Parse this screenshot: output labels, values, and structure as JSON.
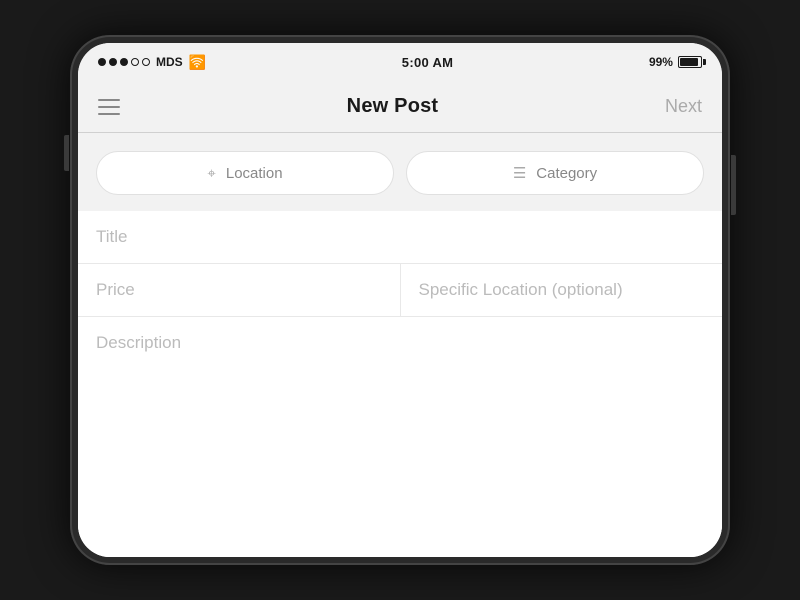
{
  "statusBar": {
    "carrier": "MDS",
    "time": "5:00 AM",
    "battery": "99%"
  },
  "navBar": {
    "title": "New Post",
    "nextLabel": "Next"
  },
  "tags": {
    "locationLabel": "Location",
    "categoryLabel": "Category"
  },
  "form": {
    "titlePlaceholder": "Title",
    "pricePlaceholder": "Price",
    "specificLocationPlaceholder": "Specific Location (optional)",
    "descriptionPlaceholder": "Description"
  }
}
